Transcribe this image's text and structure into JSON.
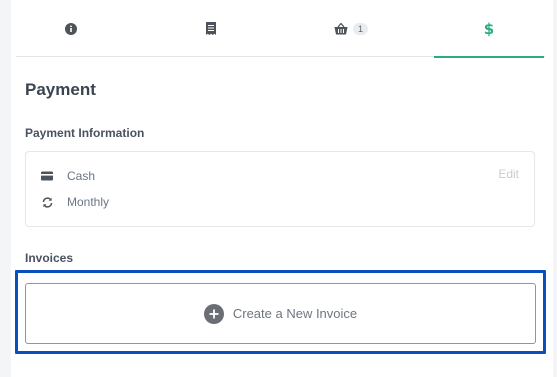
{
  "tabs": [
    {
      "icon": "info-icon"
    },
    {
      "icon": "receipt-icon"
    },
    {
      "icon": "basket-icon",
      "badge": "1"
    },
    {
      "icon": "dollar-icon",
      "label": "$",
      "active": true
    }
  ],
  "page": {
    "title": "Payment"
  },
  "payment_info": {
    "heading": "Payment Information",
    "edit_label": "Edit",
    "method": {
      "icon": "credit-card-icon",
      "value": "Cash"
    },
    "frequency": {
      "icon": "refresh-icon",
      "value": "Monthly"
    }
  },
  "invoices": {
    "heading": "Invoices",
    "create_label": "Create a New Invoice",
    "create_icon": "plus-circle-icon"
  },
  "colors": {
    "accent": "#27ae7a",
    "highlight": "#0a4fbf"
  }
}
